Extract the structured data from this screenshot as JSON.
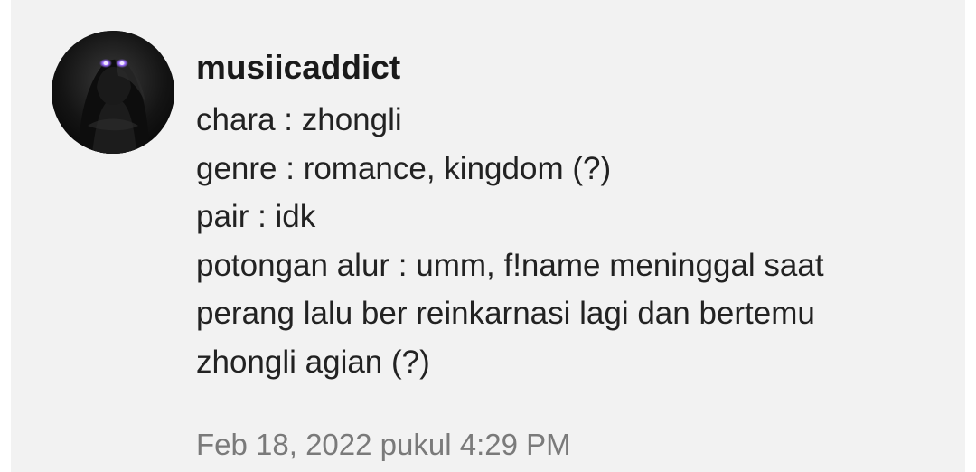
{
  "comment": {
    "username": "musiicaddict",
    "lines": [
      "chara : zhongli",
      "genre : romance, kingdom (?)",
      "pair : idk",
      "potongan alur : umm, f!name meninggal saat",
      "perang lalu ber reinkarnasi lagi dan bertemu",
      "zhongli agian (?)"
    ],
    "timestamp": "Feb 18, 2022 pukul 4:29 PM"
  },
  "colors": {
    "background": "#f2f2f2",
    "username": "#1a1a1a",
    "body_text": "#222222",
    "timestamp": "#7a7a7a",
    "avatar_eyes": "#9b6bff"
  },
  "avatar": {
    "icon": "dark-hooded-figure-avatar"
  }
}
